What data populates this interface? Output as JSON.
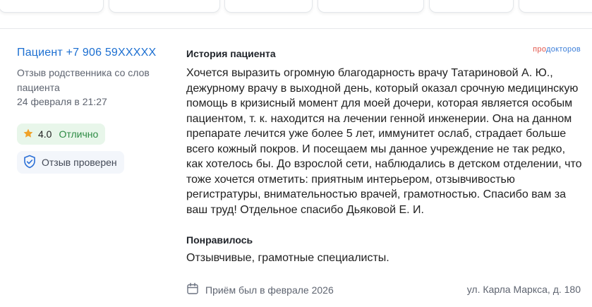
{
  "review": {
    "author": "Пациент +7 906 59XXXXX",
    "author_role": "Отзыв родственника со слов пациента",
    "date": "24 февраля в 21:27",
    "rating": {
      "score": "4.0",
      "label": "Отлично",
      "star_color": "#f0a229",
      "label_color": "#2e8b44"
    },
    "verified_label": "Отзыв проверен",
    "logo": {
      "part1": "про",
      "part2": "докторов"
    },
    "story": {
      "title": "История пациента",
      "text": "Хочется выразить огромную благодарность врачу Татариновой А. Ю., дежурному врачу в выходной день, который оказал срочную медицинскую помощь в кризисный момент для моей дочери, которая является особым пациентом, т. к. находится на лечении генной инженерии. Она на данном препарате лечится уже более 5 лет, иммунитет ослаб, страдает больше всего кожный покров. И посещаем мы данное учреждение не так редко, как хотелось бы. До взрослой сети, наблюдались в детском отделении, что тоже хочется отметить: приятным интерьером, отзывчивостью регистратуры, внимательностью врачей, грамотностью. Спасибо вам за ваш труд! Отдельное спасибо Дьяковой Е. И."
    },
    "liked": {
      "title": "Понравилось",
      "text": "Отзывчивые, грамотные специалисты."
    },
    "visit": "Приём был в феврале 2026",
    "address": "ул. Карла Маркса, д. 180"
  }
}
